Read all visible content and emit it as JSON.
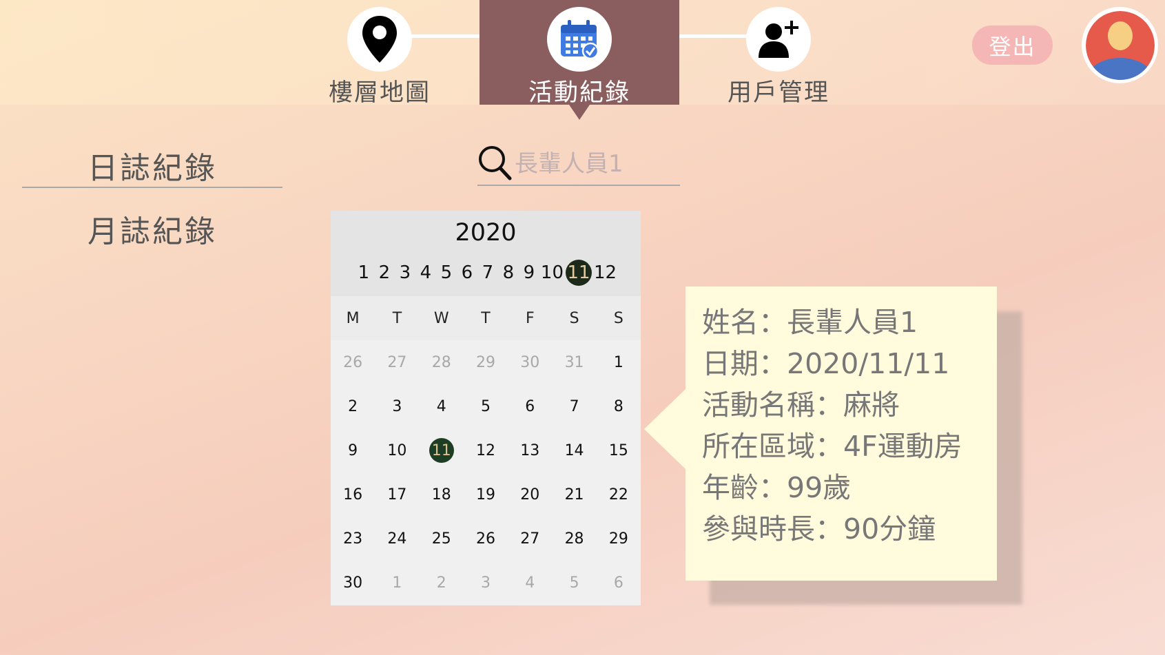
{
  "nav": {
    "items": [
      {
        "label": "樓層地圖",
        "icon": "map-pin-icon"
      },
      {
        "label": "活動紀錄",
        "icon": "calendar-check-icon",
        "active": true
      },
      {
        "label": "用戶管理",
        "icon": "add-user-icon"
      }
    ],
    "logout_label": "登出",
    "avatar_icon": "user-avatar-icon",
    "active_color": "#8a5e5e"
  },
  "sidebar": {
    "items": [
      {
        "label": "日誌紀錄",
        "selected": true
      },
      {
        "label": "月誌紀錄"
      }
    ]
  },
  "search": {
    "placeholder": "長輩人員1",
    "value": ""
  },
  "calendar": {
    "year": "2020",
    "months": [
      "1",
      "2",
      "3",
      "4",
      "5",
      "6",
      "7",
      "8",
      "9",
      "10",
      "11",
      "12"
    ],
    "selected_month": "11",
    "weekdays": [
      "M",
      "T",
      "W",
      "T",
      "F",
      "S",
      "S"
    ],
    "days": [
      {
        "d": "26",
        "other": true
      },
      {
        "d": "27",
        "other": true
      },
      {
        "d": "28",
        "other": true
      },
      {
        "d": "29",
        "other": true
      },
      {
        "d": "30",
        "other": true
      },
      {
        "d": "31",
        "other": true
      },
      {
        "d": "1"
      },
      {
        "d": "2"
      },
      {
        "d": "3"
      },
      {
        "d": "4"
      },
      {
        "d": "5"
      },
      {
        "d": "6"
      },
      {
        "d": "7"
      },
      {
        "d": "8"
      },
      {
        "d": "9"
      },
      {
        "d": "10"
      },
      {
        "d": "11",
        "selected": true
      },
      {
        "d": "12"
      },
      {
        "d": "13"
      },
      {
        "d": "14"
      },
      {
        "d": "15"
      },
      {
        "d": "16"
      },
      {
        "d": "17"
      },
      {
        "d": "18"
      },
      {
        "d": "19"
      },
      {
        "d": "20"
      },
      {
        "d": "21"
      },
      {
        "d": "22"
      },
      {
        "d": "23"
      },
      {
        "d": "24"
      },
      {
        "d": "25"
      },
      {
        "d": "26"
      },
      {
        "d": "27"
      },
      {
        "d": "28"
      },
      {
        "d": "29"
      },
      {
        "d": "30"
      },
      {
        "d": "1",
        "other": true
      },
      {
        "d": "2",
        "other": true
      },
      {
        "d": "3",
        "other": true
      },
      {
        "d": "4",
        "other": true
      },
      {
        "d": "5",
        "other": true
      },
      {
        "d": "6",
        "other": true
      }
    ],
    "selected_color": "#1d3d24"
  },
  "info": {
    "lines": [
      "姓名：長輩人員1",
      "日期：2020/11/11",
      "活動名稱：麻將",
      "所在區域：4F運動房",
      "年齡：99歲",
      "參與時長：90分鐘"
    ]
  }
}
